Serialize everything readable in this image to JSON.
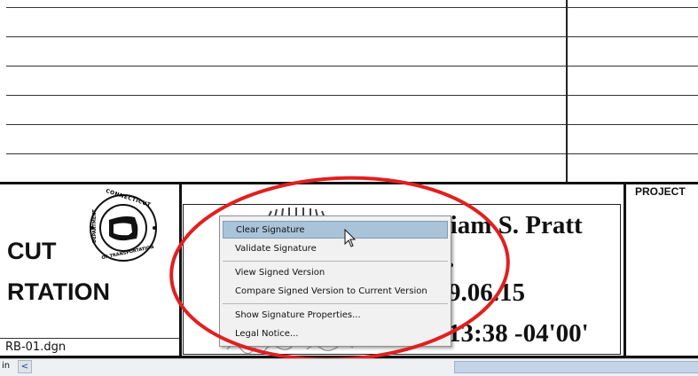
{
  "drawing": {
    "left_title_line1": "CUT",
    "left_title_line2": "RTATION",
    "filename": "RB-01.dgn",
    "project_label": "PROJECT",
    "seal_top_text": "CONNECTICUT",
    "seal_bottom_text": "OF TRANSPORTATION",
    "seal_left_text": "DEPARTMENT",
    "signature_name": "William S. Pratt",
    "signature_dot": ".",
    "signature_date": "9.06.15",
    "signature_time": "13:38 -04'00'"
  },
  "context_menu": {
    "items": [
      {
        "label": "Clear Signature",
        "highlighted": true
      },
      {
        "label": "Validate Signature"
      },
      {
        "label": "View Signed Version"
      },
      {
        "label": "Compare Signed Version to Current Version"
      },
      {
        "label": "Show Signature Properties..."
      },
      {
        "label": "Legal Notice..."
      }
    ]
  },
  "statusbar": {
    "units": "in",
    "scroll_left_arrow": "<"
  },
  "colors": {
    "annotation_circle": "#e02020",
    "menu_highlight": "#a9c3d9"
  }
}
